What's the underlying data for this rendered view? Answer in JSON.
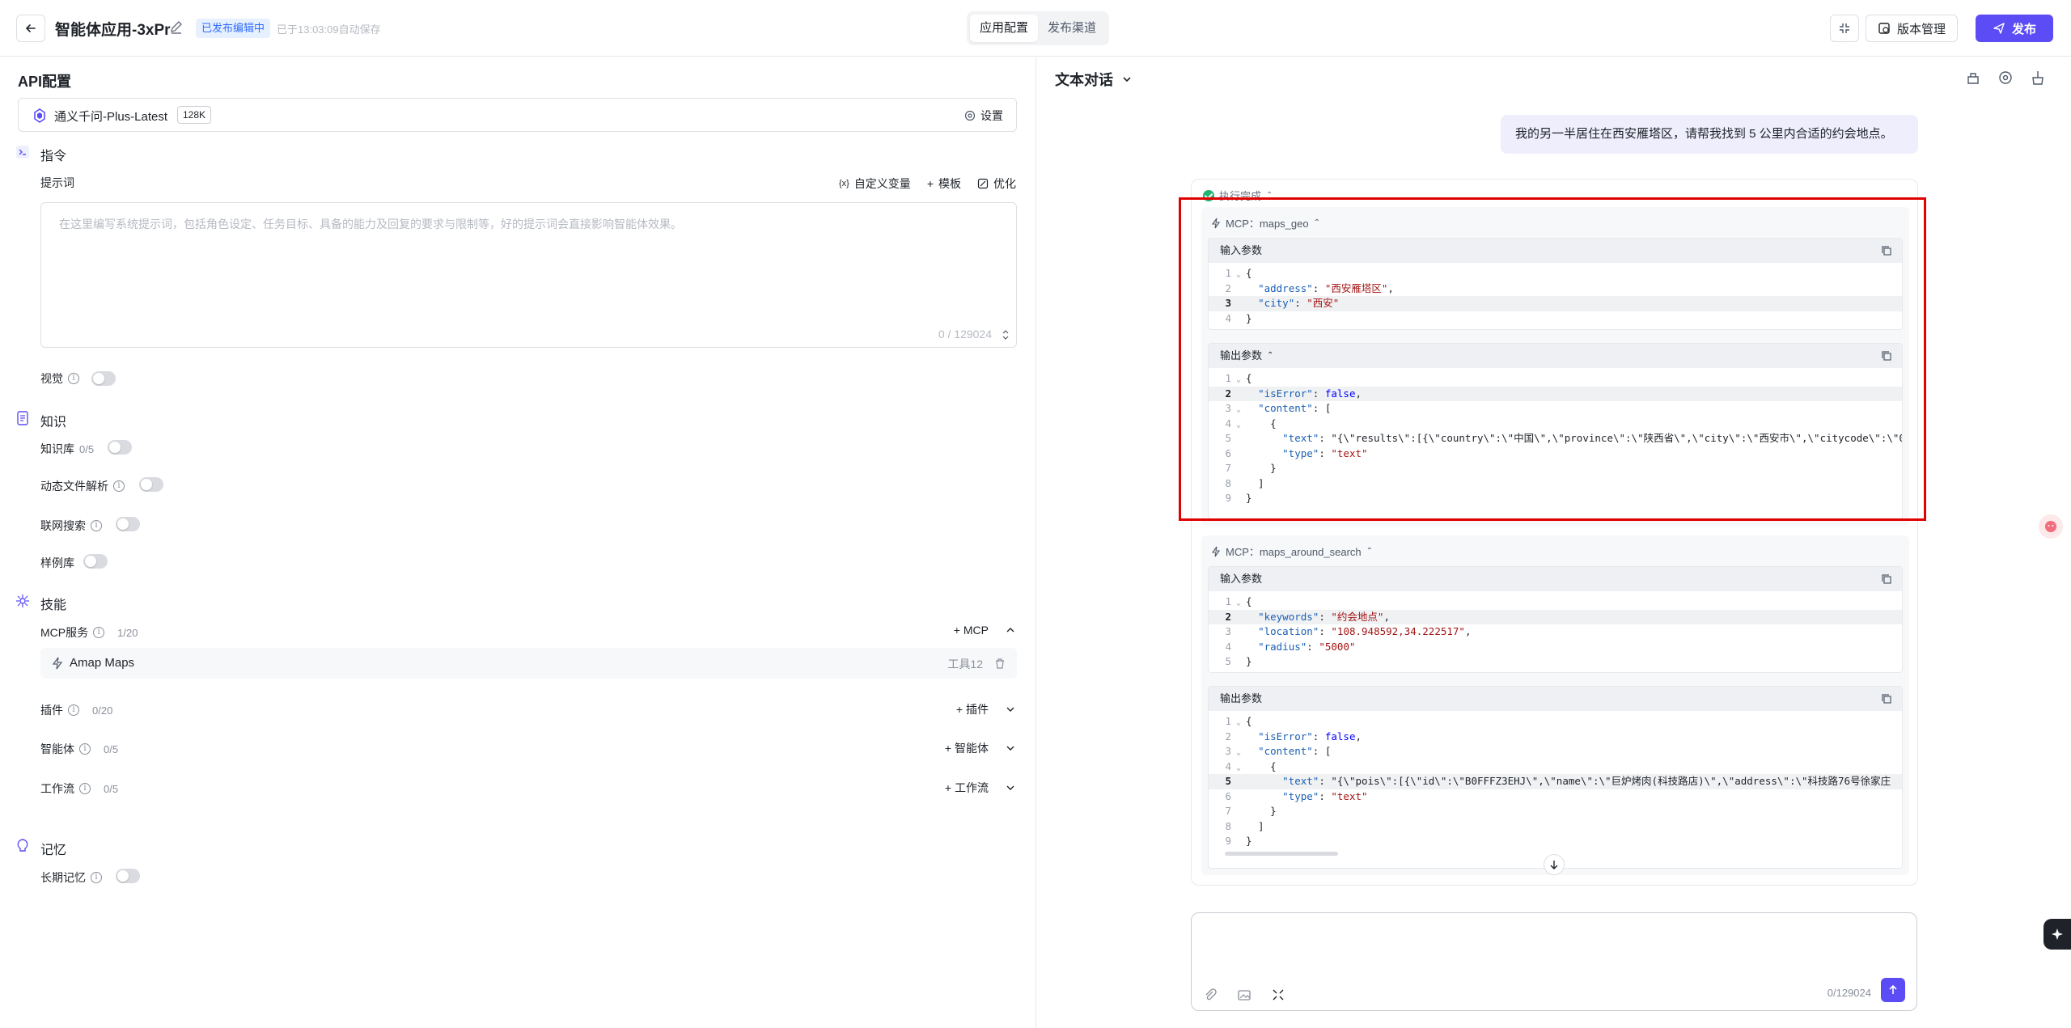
{
  "header": {
    "app_title": "智能体应用-3xPr",
    "status_badge": "已发布编辑中",
    "save_time": "已于13:03:09自动保存",
    "tabs": [
      "应用配置",
      "发布渠道"
    ],
    "version_label": "版本管理",
    "publish_label": "发布",
    "accent_color": "#5b4cf5"
  },
  "left": {
    "api_title": "API配置",
    "model": {
      "name": "通义千问-Plus-Latest",
      "context": "128K",
      "settings_label": "设置"
    },
    "instruction": {
      "title": "指令",
      "prompt_label": "提示词",
      "actions": [
        "自定义变量",
        "模板",
        "优化"
      ],
      "placeholder": "在这里编写系统提示词，包括角色设定、任务目标、具备的能力及回复的要求与限制等，好的提示词会直接影响智能体效果。",
      "counter": "0 / 129024"
    },
    "vision_label": "视觉",
    "knowledge": {
      "title": "知识",
      "kb_label": "知识库",
      "kb_count": "0/5",
      "doc_parse_label": "动态文件解析",
      "web_search_label": "联网搜索",
      "examples_label": "样例库"
    },
    "skills": {
      "title": "技能",
      "mcp_label": "MCP服务",
      "mcp_count": "1/20",
      "mcp_add": "MCP",
      "mcp_item": {
        "name": "Amap Maps",
        "tools": "工具12"
      },
      "plugin_label": "插件",
      "plugin_count": "0/20",
      "plugin_add": "插件",
      "agent_label": "智能体",
      "agent_count": "0/5",
      "agent_add": "智能体",
      "workflow_label": "工作流",
      "workflow_count": "0/5",
      "workflow_add": "工作流"
    },
    "memory": {
      "title": "记忆",
      "long_term_label": "长期记忆"
    }
  },
  "right": {
    "chat_title": "文本对话",
    "user_message": "我的另一半居住在西安雁塔区，请帮我找到 5 公里内合适的约会地点。",
    "exec_status": "执行完成",
    "calls": [
      {
        "label": "MCP：maps_geo",
        "input_label": "输入参数",
        "output_label": "输出参数",
        "input_lines": [
          "{",
          "  \"address\": \"西安雁塔区\",",
          "  \"city\": \"西安\"",
          "}"
        ],
        "output_lines": [
          "{",
          "  \"isError\": false,",
          "  \"content\": [",
          "    {",
          "      \"text\": \"{\\\"results\\\":[{\\\"country\\\":\\\"中国\\\",\\\"province\\\":\\\"陕西省\\\",\\\"city\\\":\\\"西安市\\\",\\\"citycode\\\":\\\"0",
          "      \"type\": \"text\"",
          "    }",
          "  ]",
          "}"
        ]
      },
      {
        "label": "MCP：maps_around_search",
        "input_label": "输入参数",
        "output_label": "输出参数",
        "input_lines": [
          "{",
          "  \"keywords\": \"约会地点\",",
          "  \"location\": \"108.948592,34.222517\",",
          "  \"radius\": \"5000\"",
          "}"
        ],
        "output_lines": [
          "{",
          "  \"isError\": false,",
          "  \"content\": [",
          "    {",
          "      \"text\": \"{\\\"pois\\\":[{\\\"id\\\":\\\"B0FFFZ3EHJ\\\",\\\"name\\\":\\\"巨炉烤肉(科技路店)\\\",\\\"address\\\":\\\"科技路76号徐家庄",
          "      \"type\": \"text\"",
          "    }",
          "  ]",
          "}"
        ]
      }
    ],
    "input_counter": "0/129024"
  }
}
